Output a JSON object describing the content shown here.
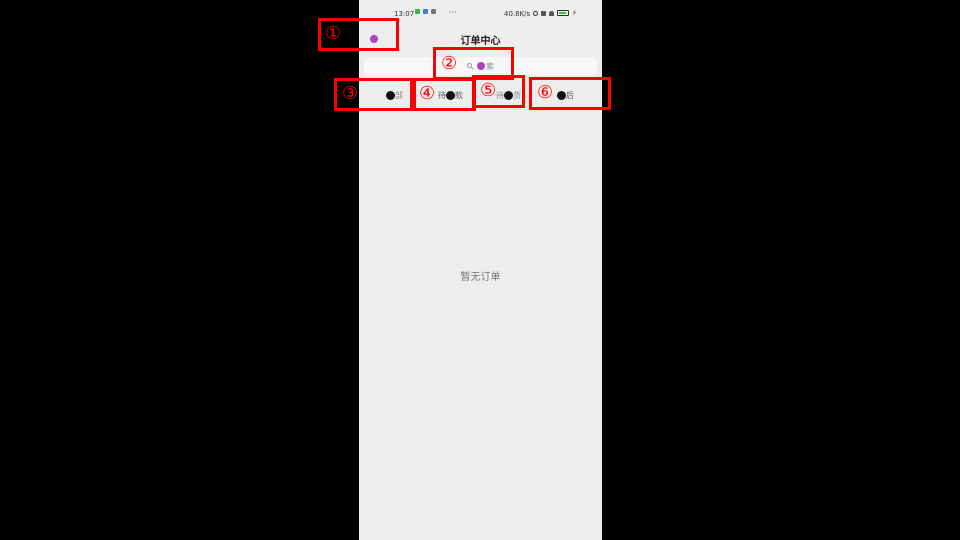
{
  "status_bar": {
    "time": "13:07",
    "dots": "···",
    "speed": "40.8K/s"
  },
  "header": {
    "title": "订单中心"
  },
  "search": {
    "placeholder_suffix": "索"
  },
  "tabs": {
    "all_suffix": "部",
    "pending_pay_prefix": "待",
    "pending_pay_suffix": "款",
    "pending_ship_prefix": "待",
    "pending_ship_suffix": "货",
    "after_sale_suffix": "后"
  },
  "empty_state": {
    "text": "暂无订单"
  },
  "markers": {
    "m1": "①",
    "m2": "②",
    "m3": "③",
    "m4": "④",
    "m5": "⑤",
    "m6": "⑥"
  },
  "colors": {
    "background": "#ededed",
    "marker": "#ff0000",
    "redacted_purple": "#b041c7",
    "redacted_black": "#111111"
  }
}
